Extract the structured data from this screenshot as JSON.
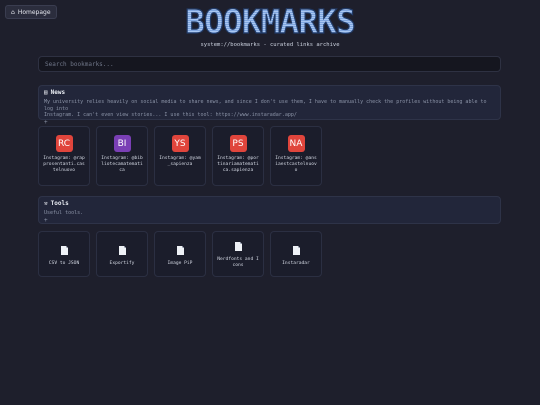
{
  "header": {
    "home_label": "Homepage",
    "logo_text": "BOOKMARKS",
    "subtitle": "system://bookmarks - curated links archive"
  },
  "search": {
    "placeholder": "Search bookmarks..."
  },
  "sections": [
    {
      "title": "News",
      "icon": "newspaper-icon",
      "description_line1": "My university relies heavily on social media to share news, and since I don't use them, I have to manually check the profiles without being able to log into",
      "description_line2": "Instagram. I can't even view stories... I use this tool: https://www.instaradar.app/",
      "toggle": "+",
      "items": [
        {
          "initials": "RC",
          "label": "Instagram: @rapprosentanti.castelnuovo",
          "color": "#e0453c"
        },
        {
          "initials": "BI",
          "label": "Instagram: @bibliotecamatematica",
          "color": "#7a3fb5"
        },
        {
          "initials": "YS",
          "label": "Instagram: @yam_sapienza",
          "color": "#e0453c"
        },
        {
          "initials": "PS",
          "label": "Instagram: @portinariamatematica.sapienza",
          "color": "#e0453c"
        },
        {
          "initials": "NA",
          "label": "Instagram: @ansiaestcastelnuovo",
          "color": "#e0453c"
        }
      ]
    },
    {
      "title": "Tools",
      "icon": "wrench-icon",
      "description_line1": "Useful tools.",
      "toggle": "+",
      "items": [
        {
          "label": "CSV to JSON",
          "icon": "document-icon"
        },
        {
          "label": "Exportify",
          "icon": "document-icon"
        },
        {
          "label": "Image PiP",
          "icon": "document-icon"
        },
        {
          "label": "Nerdfonts and Icons",
          "icon": "document-icon"
        },
        {
          "label": "Instaradar",
          "icon": "document-icon"
        }
      ]
    }
  ]
}
